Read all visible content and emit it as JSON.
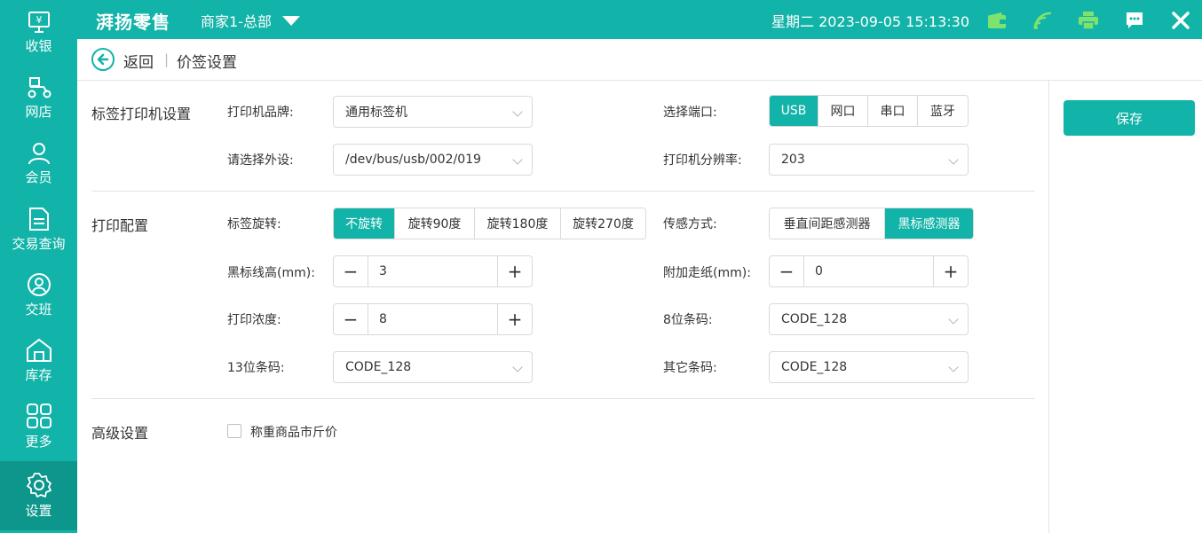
{
  "topbar": {
    "brand": "湃扬零售",
    "store": "商家1-总部",
    "datetime": "星期二 2023-09-05 15:13:30"
  },
  "sidebar": {
    "items": [
      {
        "label": "收银",
        "icon": "cashier-monitor-icon"
      },
      {
        "label": "网店",
        "icon": "scooter-icon"
      },
      {
        "label": "会员",
        "icon": "user-icon"
      },
      {
        "label": "交易查询",
        "icon": "document-icon"
      },
      {
        "label": "交班",
        "icon": "shift-handover-icon"
      },
      {
        "label": "库存",
        "icon": "warehouse-icon"
      },
      {
        "label": "更多",
        "icon": "grid-icon"
      },
      {
        "label": "设置",
        "icon": "gear-icon"
      }
    ],
    "active": "设置"
  },
  "header": {
    "back": "返回",
    "separator": "|",
    "title": "价签设置"
  },
  "save_label": "保存",
  "printer_section": {
    "title": "标签打印机设置",
    "brand_label": "打印机品牌:",
    "brand_value": "通用标签机",
    "port_label": "选择端口:",
    "ports": [
      "USB",
      "网口",
      "串口",
      "蓝牙"
    ],
    "port_selected": "USB",
    "device_label": "请选择外设:",
    "device_value": "/dev/bus/usb/002/019",
    "resolution_label": "打印机分辨率:",
    "resolution_value": "203"
  },
  "print_section": {
    "title": "打印配置",
    "rotation_label": "标签旋转:",
    "rotations": [
      "不旋转",
      "旋转90度",
      "旋转180度",
      "旋转270度"
    ],
    "rotation_selected": "不旋转",
    "sensor_label": "传感方式:",
    "sensors": [
      "垂直间距感测器",
      "黑标感测器"
    ],
    "sensor_selected": "黑标感测器",
    "black_line_label": "黑标线高(mm):",
    "black_line_value": "3",
    "extra_feed_label": "附加走纸(mm):",
    "extra_feed_value": "0",
    "density_label": "打印浓度:",
    "density_value": "8",
    "barcode8_label": "8位条码:",
    "barcode8_value": "CODE_128",
    "barcode13_label": "13位条码:",
    "barcode13_value": "CODE_128",
    "other_barcode_label": "其它条码:",
    "other_barcode_value": "CODE_128",
    "minus": "−",
    "plus": "+"
  },
  "advanced_section": {
    "title": "高级设置",
    "checkbox_label": "称重商品市斤价",
    "checked": false
  },
  "colors": {
    "accent": "#12b3a8",
    "active_sidebar": "#0c968c",
    "border": "#d9d9d9"
  }
}
